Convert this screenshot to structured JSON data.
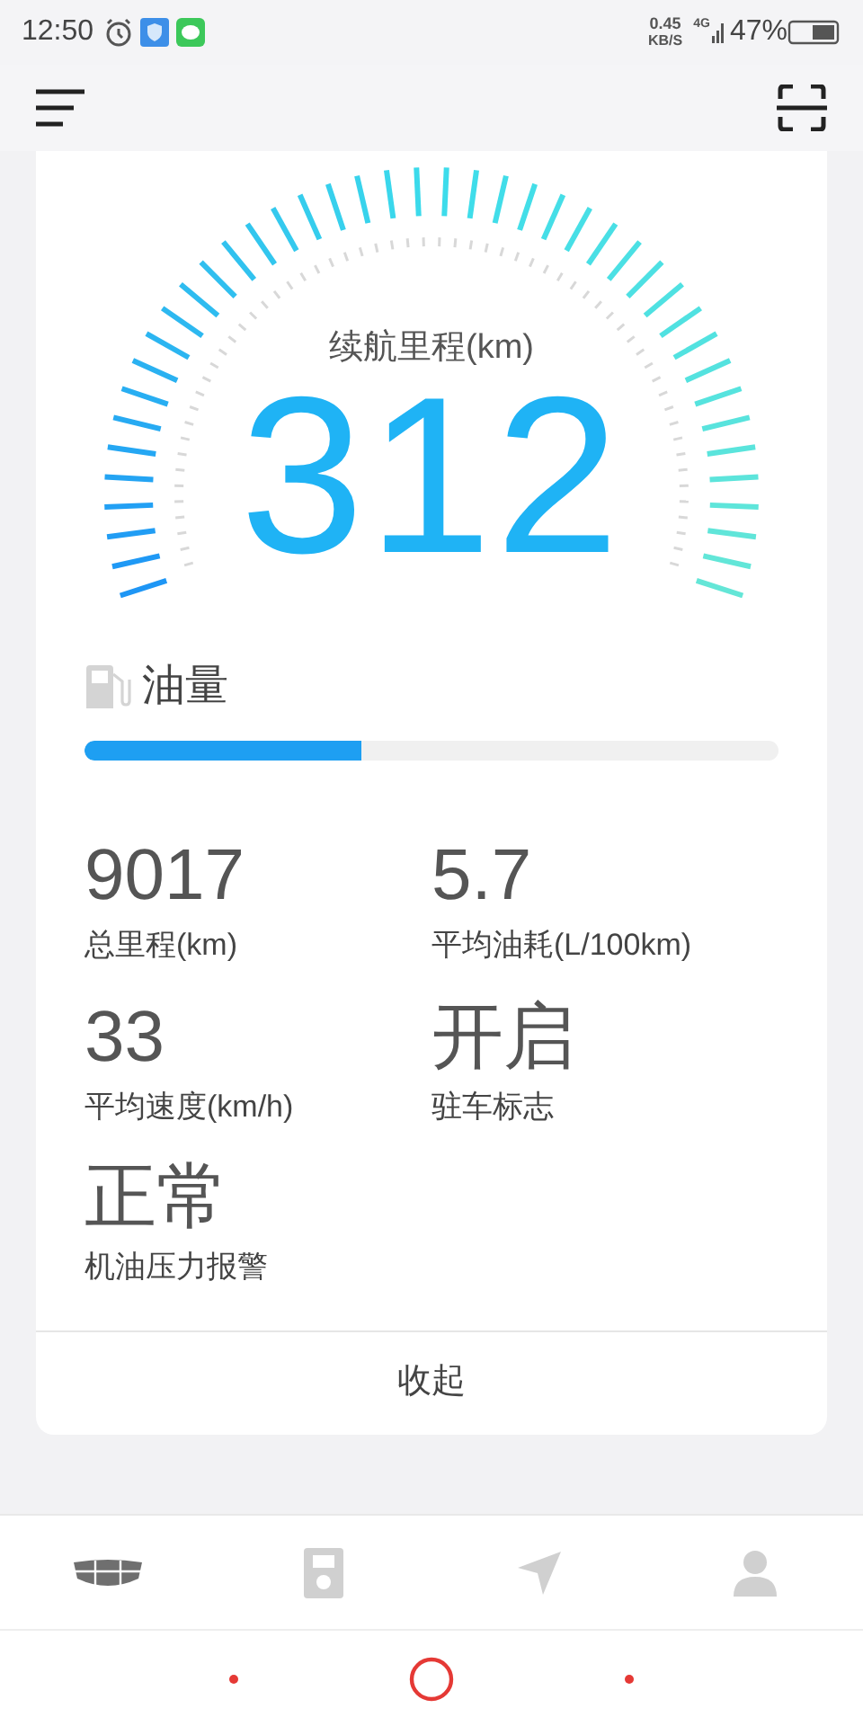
{
  "status_bar": {
    "time": "12:50",
    "net_speed_value": "0.45",
    "net_speed_unit": "KB/S",
    "network": "4G",
    "battery": "47%"
  },
  "gauge": {
    "label": "续航里程(km)",
    "value": "312"
  },
  "fuel": {
    "label": "油量",
    "level": 0.4
  },
  "stats": [
    {
      "value": "9017",
      "label": "总里程(km)"
    },
    {
      "value": "5.7",
      "label": "平均油耗(L/100km)"
    },
    {
      "value": "33",
      "label": "平均速度(km/h)"
    },
    {
      "value": "开启",
      "label": "驻车标志"
    },
    {
      "value": "正常",
      "label": "机油压力报警"
    }
  ],
  "collapse_button": "收起",
  "bottom_tabs": [
    {
      "kind": "car",
      "selected": true
    },
    {
      "kind": "device",
      "selected": false
    },
    {
      "kind": "navigation",
      "selected": false
    },
    {
      "kind": "profile",
      "selected": false
    }
  ]
}
